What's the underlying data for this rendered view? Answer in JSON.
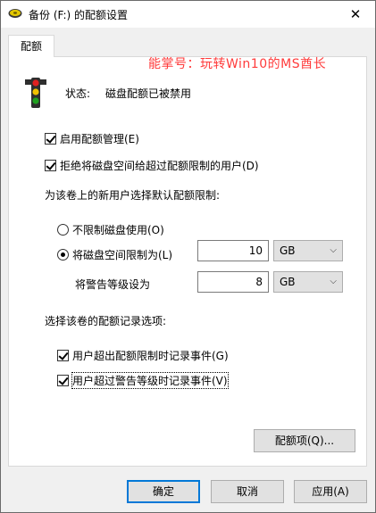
{
  "window": {
    "title": "备份 (F:) 的配额设置",
    "close_glyph": "✕"
  },
  "watermark": "能掌号：玩转Win10的MS酋长",
  "tab": {
    "label": "配额"
  },
  "status": {
    "label": "状态:",
    "value": "磁盘配额已被禁用",
    "icon": "traffic-light-icon"
  },
  "options": {
    "enable_quota": "启用配额管理(E)",
    "deny_space": "拒绝将磁盘空间给超过配额限制的用户(D)"
  },
  "default_limit": {
    "heading": "为该卷上的新用户选择默认配额限制:",
    "no_limit": "不限制磁盘使用(O)",
    "limit_to": "将磁盘空间限制为(L)",
    "limit_value": "10",
    "limit_unit": "GB",
    "warning_label": "将警告等级设为",
    "warning_value": "8",
    "warning_unit": "GB"
  },
  "logging": {
    "heading": "选择该卷的配额记录选项:",
    "log_limit": "用户超出配额限制时记录事件(G)",
    "log_warning": "用户超过警告等级时记录事件(V)"
  },
  "buttons": {
    "entries": "配额项(Q)...",
    "ok": "确定",
    "cancel": "取消",
    "apply": "应用(A)"
  },
  "colors": {
    "watermark": "#ff3b3b",
    "accent": "#0078d7"
  }
}
